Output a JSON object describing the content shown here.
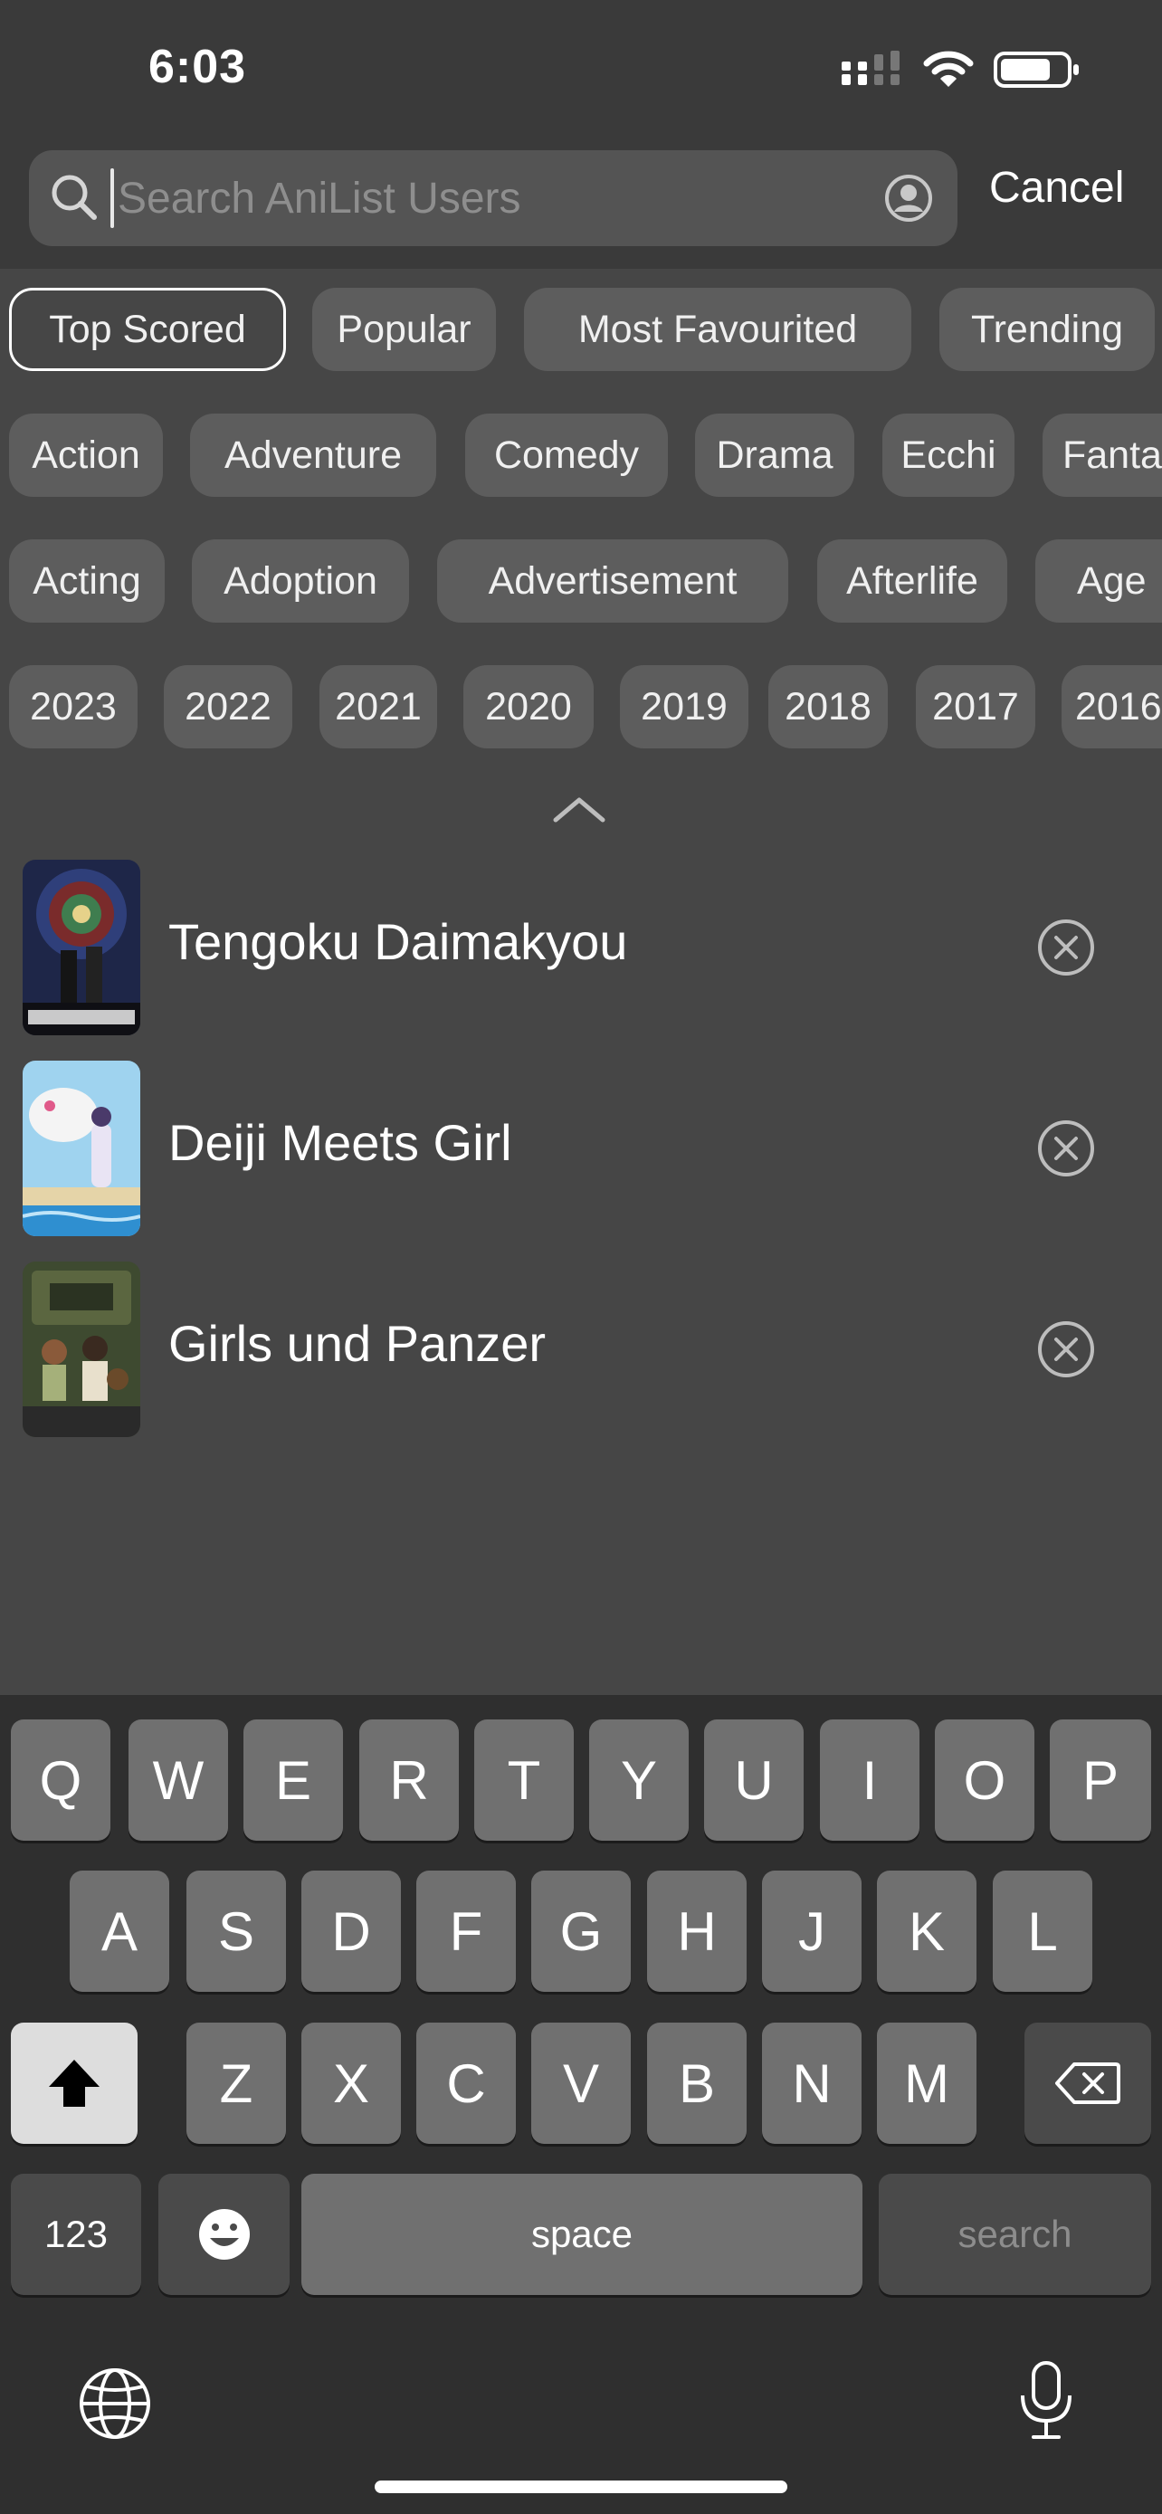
{
  "status": {
    "time": "6:03"
  },
  "search": {
    "placeholder": "Search AniList Users",
    "value": "",
    "cancel_label": "Cancel"
  },
  "sort_chips": [
    {
      "label": "Top Scored",
      "selected": true
    },
    {
      "label": "Popular",
      "selected": false
    },
    {
      "label": "Most Favourited",
      "selected": false
    },
    {
      "label": "Trending",
      "selected": false
    }
  ],
  "genre_chips": [
    "Action",
    "Adventure",
    "Comedy",
    "Drama",
    "Ecchi",
    "Fanta"
  ],
  "tag_chips": [
    "Acting",
    "Adoption",
    "Advertisement",
    "Afterlife",
    "Age"
  ],
  "year_chips": [
    "2023",
    "2022",
    "2021",
    "2020",
    "2019",
    "2018",
    "2017",
    "2016"
  ],
  "recent_items": [
    {
      "title": "Tengoku Daimakyou",
      "cover_colors": [
        "#2a3a6b",
        "#b33a3a",
        "#3f7d4f",
        "#e6d28a"
      ]
    },
    {
      "title": "Deiji Meets Girl",
      "cover_colors": [
        "#8ec8e8",
        "#f2f2f2",
        "#3a9ad6",
        "#d9c8a0"
      ]
    },
    {
      "title": "Girls und Panzer",
      "cover_colors": [
        "#4f5a3a",
        "#2d3a2d",
        "#a5b07a",
        "#d8c9b0"
      ]
    }
  ],
  "keyboard": {
    "row1": [
      "Q",
      "W",
      "E",
      "R",
      "T",
      "Y",
      "U",
      "I",
      "O",
      "P"
    ],
    "row2": [
      "A",
      "S",
      "D",
      "F",
      "G",
      "H",
      "J",
      "K",
      "L"
    ],
    "row3": [
      "Z",
      "X",
      "C",
      "V",
      "B",
      "N",
      "M"
    ],
    "numbers_label": "123",
    "space_label": "space",
    "search_label": "search"
  }
}
